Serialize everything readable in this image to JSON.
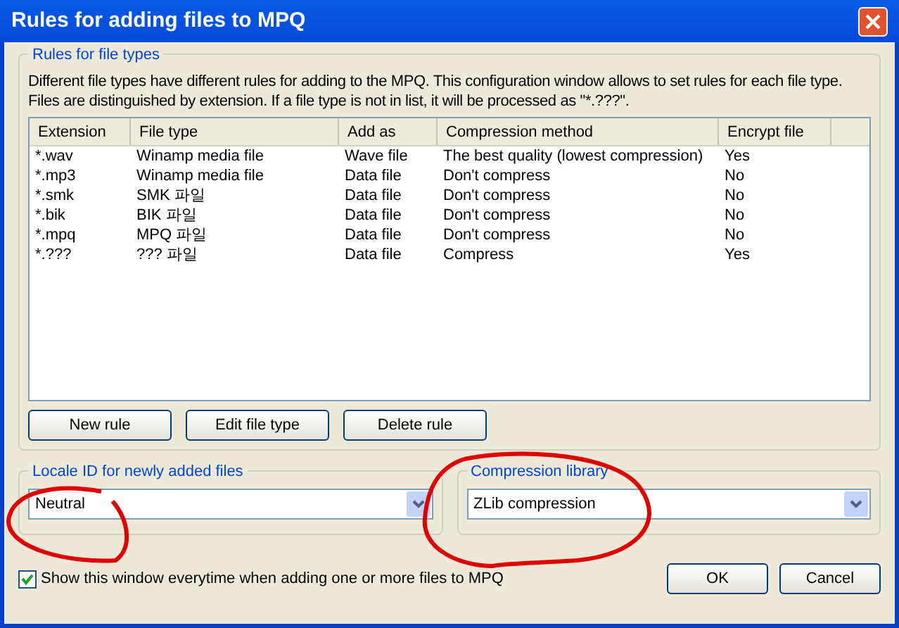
{
  "window": {
    "title": "Rules for adding files to MPQ"
  },
  "rules_group": {
    "title": "Rules for file types",
    "description": "Different file types have different rules for adding to the MPQ. This configuration window allows to set rules for each file type. Files are distinguished by extension. If a file type is not in list, it will be processed as \"*.???\"."
  },
  "table": {
    "columns": [
      "Extension",
      "File type",
      "Add as",
      "Compression method",
      "Encrypt file"
    ],
    "rows": [
      [
        "*.wav",
        "Winamp media file",
        "Wave file",
        "The best quality (lowest compression)",
        "Yes"
      ],
      [
        "*.mp3",
        "Winamp media file",
        "Data file",
        "Don't compress",
        "No"
      ],
      [
        "*.smk",
        "SMK 파일",
        "Data file",
        "Don't compress",
        "No"
      ],
      [
        "*.bik",
        "BIK 파일",
        "Data file",
        "Don't compress",
        "No"
      ],
      [
        "*.mpq",
        "MPQ 파일",
        "Data file",
        "Don't compress",
        "No"
      ],
      [
        "*.???",
        "??? 파일",
        "Data file",
        "Compress",
        "Yes"
      ]
    ]
  },
  "rule_buttons": [
    "New rule",
    "Edit file type",
    "Delete rule"
  ],
  "locale_group": {
    "title": "Locale ID for newly added files",
    "value": "Neutral"
  },
  "compression_group": {
    "title": "Compression library",
    "value": "ZLib compression"
  },
  "show_window_checkbox": {
    "label": "Show this window everytime when adding one or more files to MPQ",
    "checked": true
  },
  "dialog_buttons": [
    "OK",
    "Cancel"
  ]
}
